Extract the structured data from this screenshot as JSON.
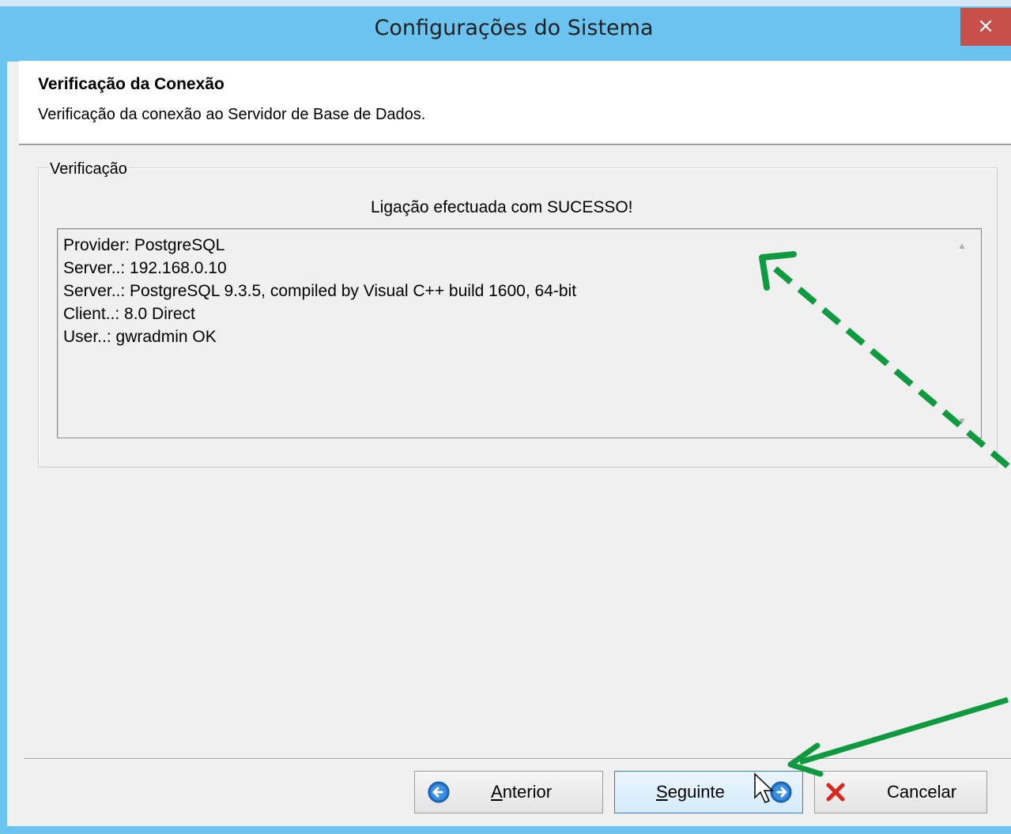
{
  "window": {
    "title": "Configurações do Sistema",
    "close_glyph": "×",
    "title_bar_color": "#6bc3f0",
    "close_color": "#c7504b"
  },
  "header": {
    "title": "Verificação da Conexão",
    "subtitle": "Verificação da conexão ao Servidor de Base de Dados."
  },
  "group": {
    "legend": "Verificação",
    "status": "Ligação efectuada com SUCESSO!",
    "log_lines": [
      "Provider: PostgreSQL",
      "Server..: 192.168.0.10",
      "Server..: PostgreSQL 9.3.5, compiled by Visual C++ build 1600, 64-bit",
      "Client..: 8.0 Direct",
      "User..: gwradmin OK"
    ]
  },
  "buttons": {
    "back": {
      "access_key": "A",
      "rest": "nterior",
      "icon": "arrow-left-circle-icon"
    },
    "next": {
      "access_key": "S",
      "rest": "eguinte",
      "icon": "arrow-right-circle-icon"
    },
    "cancel": {
      "label": "Cancelar",
      "icon": "red-x-icon"
    }
  },
  "annotation": {
    "arrow_color": "#109a40"
  }
}
